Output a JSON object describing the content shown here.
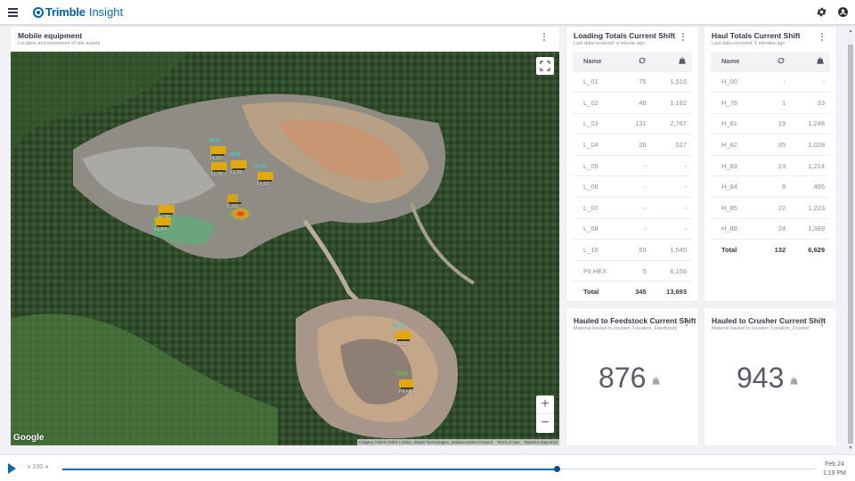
{
  "header": {
    "brand": "Trimble",
    "product": "Insight",
    "icons": [
      "menu-icon",
      "settings-icon",
      "account-icon"
    ]
  },
  "mobile_equipment": {
    "title": "Mobile equipment",
    "subtitle": "Location and movement of site assets",
    "map": {
      "provider_logo": "Google",
      "attribution": "Imagery ©2020 CNES / Airbus, Maxar Technologies, Waikato District Council",
      "terms": "Terms of Use",
      "report": "Report a map error",
      "zoom_in": "+",
      "zoom_out": "−",
      "assets": [
        {
          "label": "H_82",
          "time": "05:00"
        },
        {
          "label": "H_78",
          "time": ""
        },
        {
          "label": "H_81",
          "time": "02:05"
        },
        {
          "label": "H_83",
          "time": "01:16"
        },
        {
          "label": "L_03",
          "time": ""
        },
        {
          "label": "H_00",
          "time": ""
        },
        {
          "label": "H_84",
          "time": ""
        },
        {
          "label": "H_85",
          "time": "02:45"
        },
        {
          "label": "Pit HEX",
          "time": "10:00"
        }
      ]
    }
  },
  "loading_totals": {
    "title": "Loading Totals Current Shift",
    "subtitle": "Last data received: a minute ago",
    "columns": [
      "Name",
      "cycles-icon",
      "weight-icon"
    ],
    "rows": [
      {
        "name": "L_01",
        "loads": "75",
        "tonnes": "1,516"
      },
      {
        "name": "L_02",
        "loads": "49",
        "tonnes": "1,182"
      },
      {
        "name": "L_03",
        "loads": "131",
        "tonnes": "2,767"
      },
      {
        "name": "L_04",
        "loads": "26",
        "tonnes": "527"
      },
      {
        "name": "L_05",
        "loads": "-",
        "tonnes": "-"
      },
      {
        "name": "L_06",
        "loads": "-",
        "tonnes": "-"
      },
      {
        "name": "L_07",
        "loads": "-",
        "tonnes": "-"
      },
      {
        "name": "L_08",
        "loads": "-",
        "tonnes": "-"
      },
      {
        "name": "L_10",
        "loads": "59",
        "tonnes": "1,545"
      },
      {
        "name": "Pit HEX",
        "loads": "5",
        "tonnes": "6,156"
      }
    ],
    "total": {
      "name": "Total",
      "loads": "345",
      "tonnes": "13,693"
    }
  },
  "haul_totals": {
    "title": "Haul Totals Current Shift",
    "subtitle": "Last data received: 5 minutes ago",
    "columns": [
      "Name",
      "cycles-icon",
      "weight-icon"
    ],
    "rows": [
      {
        "name": "H_00",
        "loads": "-",
        "tonnes": "-"
      },
      {
        "name": "H_78",
        "loads": "1",
        "tonnes": "33"
      },
      {
        "name": "H_81",
        "loads": "19",
        "tonnes": "1,248"
      },
      {
        "name": "H_82",
        "loads": "35",
        "tonnes": "1,028"
      },
      {
        "name": "H_83",
        "loads": "23",
        "tonnes": "1,214"
      },
      {
        "name": "H_84",
        "loads": "8",
        "tonnes": "495"
      },
      {
        "name": "H_85",
        "loads": "22",
        "tonnes": "1,223"
      },
      {
        "name": "H_88",
        "loads": "24",
        "tonnes": "1,389"
      }
    ],
    "total": {
      "name": "Total",
      "loads": "132",
      "tonnes": "6,629"
    }
  },
  "feedstock": {
    "title": "Hauled to Feedstock Current Shift",
    "subtitle": "Material hauled to location 'Location_Feedstock'",
    "value": "876"
  },
  "crusher": {
    "title": "Hauled to Crusher Current Shift",
    "subtitle": "Material hauled to location 'Location_Crusher'",
    "value": "943"
  },
  "timeline": {
    "speed": "x 100",
    "progress": 0.657,
    "date": "Feb 24",
    "time": "1:19 PM"
  },
  "colors": {
    "brand": "#0063a3",
    "accent": "#0e6aae",
    "text": "#363545",
    "muted": "#8c8b96",
    "truck": "#e0a910",
    "time_label": "#39d2d8"
  }
}
